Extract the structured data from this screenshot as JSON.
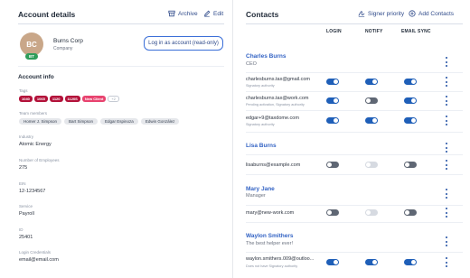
{
  "account": {
    "header_title": "Account details",
    "archive_label": "Archive",
    "edit_label": "Edit",
    "avatar_initials": "BC",
    "avatar_badge": "BT",
    "company_name": "Burns Corp",
    "company_type": "Company",
    "login_button": "Log in as account (read-only)",
    "info_title": "Account info",
    "tags_label": "Tags",
    "tags": [
      "1040",
      "1065",
      "1120",
      "1120S",
      "New Client",
      "+2"
    ],
    "team_label": "Team members",
    "team_members": [
      "Homer J. Simpson",
      "Bart Simpson",
      "Edgar Espinoza",
      "Edwin González"
    ],
    "fields": [
      {
        "label": "Industry",
        "value": "Atomic Energy"
      },
      {
        "label": "Number of Employees",
        "value": "275"
      },
      {
        "label": "EIN",
        "value": "12-1234567"
      },
      {
        "label": "Service",
        "value": "Payroll"
      },
      {
        "label": "ID",
        "value": "25401"
      },
      {
        "label": "Login Credentials",
        "value": "email@email.com"
      }
    ]
  },
  "contacts": {
    "header_title": "Contacts",
    "signer_priority_label": "Signer priority",
    "add_contacts_label": "Add Contacts",
    "columns": {
      "login": "LOGIN",
      "notify": "NOTIFY",
      "email_sync": "EMAIL SYNC"
    },
    "people": [
      {
        "name": "Charles Burns",
        "role": "CEO",
        "emails": [
          {
            "address": "charlesburns.tax@gmail.com",
            "note": "Signatory authority",
            "login": "on",
            "notify": "on",
            "email_sync": "on"
          },
          {
            "address": "charlesburns.tax@work.com",
            "note": "Pending activation, Signatory authority",
            "login": "on",
            "notify": "off",
            "email_sync": "on"
          },
          {
            "address": "edgar+9@taxdome.com",
            "note": "Signatory authority",
            "login": "on",
            "notify": "on",
            "email_sync": "on"
          }
        ]
      },
      {
        "name": "Lisa Burns",
        "role": "",
        "emails": [
          {
            "address": "lisaburns@example.com",
            "note": "",
            "login": "off",
            "notify": "disabled",
            "email_sync": "off"
          }
        ]
      },
      {
        "name": "Mary Jane",
        "role": "Manager",
        "emails": [
          {
            "address": "mary@new-work.com",
            "note": "",
            "login": "off",
            "notify": "disabled",
            "email_sync": "off"
          }
        ]
      },
      {
        "name": "Waylon Smithers",
        "role": "The best helper ever!",
        "emails": [
          {
            "address": "waylon.smithers.009@outloo...",
            "note": "Does not have Signatory authority",
            "login": "on",
            "notify": "on",
            "email_sync": "on"
          }
        ]
      }
    ]
  }
}
